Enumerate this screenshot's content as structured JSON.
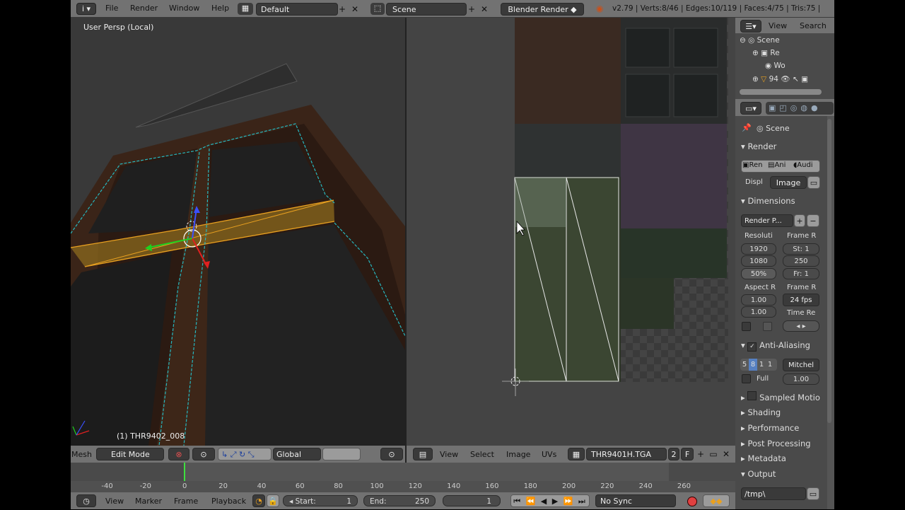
{
  "topbar": {
    "menus": [
      "File",
      "Render",
      "Window",
      "Help"
    ],
    "layout": "Default",
    "scene": "Scene",
    "engine": "Blender Render",
    "stats": "v2.79 | Verts:8/46 | Edges:10/119 | Faces:4/75 | Tris:75 |"
  },
  "viewport": {
    "label": "User Persp (Local)",
    "object_label": "(1) THR9402_008",
    "header": {
      "mesh": "Mesh",
      "mode": "Edit Mode",
      "orientation": "Global"
    }
  },
  "uv_editor": {
    "header": {
      "menus": [
        "View",
        "Select",
        "Image",
        "UVs"
      ],
      "image": "THR9401H.TGA",
      "users": "2",
      "fake": "F"
    }
  },
  "outliner": {
    "tabs": [
      "View",
      "Search"
    ],
    "items": [
      "Scene",
      "Re",
      "Wo",
      "94"
    ]
  },
  "properties": {
    "context": "Scene",
    "render_title": "Render",
    "render_buttons": [
      "Ren",
      "Ani",
      "Audi"
    ],
    "display_label": "Displ",
    "display_value": "Image",
    "dimensions_title": "Dimensions",
    "preset": "Render P...",
    "resolution_label": "Resoluti",
    "res_x": "1920",
    "res_y": "1080",
    "res_pct": "50%",
    "frame_range_label": "Frame R",
    "frame_start": "St: 1",
    "frame_end": "250",
    "frame_step": "Fr: 1",
    "aspect_label": "Aspect R",
    "aspect_x": "1.00",
    "aspect_y": "1.00",
    "frame_rate_label": "Frame R",
    "fps": "24 fps",
    "time_label": "Time Re",
    "aa_title": "Anti-Aliasing",
    "aa_samples": [
      "5",
      "8",
      "1",
      "1"
    ],
    "aa_filter": "Mitchel",
    "full_label": "Full",
    "filter_size": "1.00",
    "collapsed_panels": [
      "Sampled Motio",
      "Shading",
      "Performance",
      "Post Processing",
      "Metadata"
    ],
    "output_title": "Output",
    "output_path": "/tmp\\"
  },
  "timeline": {
    "ticks": [
      "-40",
      "-20",
      "0",
      "20",
      "40",
      "60",
      "80",
      "100",
      "120",
      "140",
      "160",
      "180",
      "200",
      "220",
      "240",
      "260"
    ],
    "current_frame_marker": 0
  },
  "bottombar": {
    "menus": [
      "View",
      "Marker",
      "Frame",
      "Playback"
    ],
    "start_label": "Start:",
    "start_value": "1",
    "end_label": "End:",
    "end_value": "250",
    "current": "1",
    "sync": "No Sync"
  },
  "colors": {
    "header": "#727272",
    "panel": "#4a4a4a",
    "viewport_bg": "#393939",
    "uv_bg": "#444444",
    "selection": "#e8a020",
    "accent": "#5680c2"
  }
}
